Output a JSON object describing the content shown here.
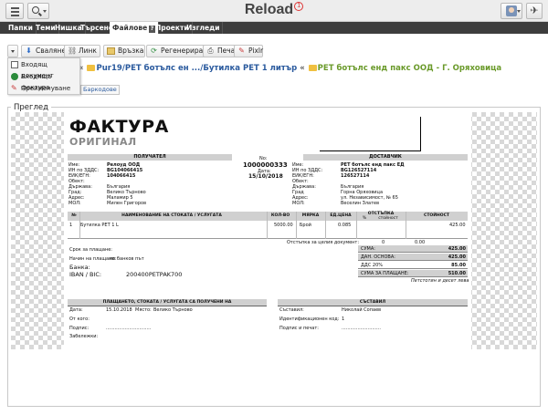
{
  "header": {
    "title": "Reload",
    "badge": "1",
    "pin_glyph": "✈"
  },
  "nav": {
    "tabs": [
      {
        "label": "Папки"
      },
      {
        "label": "Теми"
      },
      {
        "label": "Нишка"
      },
      {
        "label": "Търсене"
      },
      {
        "label": "Файлове",
        "badge": "?"
      },
      {
        "label": "Проекти"
      },
      {
        "label": "Изгледи"
      }
    ],
    "active": "Файлове"
  },
  "toolbar": {
    "download": "Сваляне",
    "link": "Линк",
    "relation": "Връзка",
    "regenerate": "Регенериране",
    "print": "Печат",
    "pixlr": "Pixlr"
  },
  "dropdown": {
    "items": [
      "Входящ документ",
      "Входяща фактура",
      "Преименуване"
    ]
  },
  "breadcrumb": {
    "part1": "Pur19/PET ботълс ен ...",
    "part2": "/Бутилка PET 1 литър",
    "part3": "PET ботълс енд пакс ООД - Г. Оряховица",
    "sep": "«"
  },
  "barcode_button": "Баркодове",
  "preview_label": "Преглед",
  "invoice": {
    "title": "ФАКТУРА",
    "subtitle": "ОРИГИНАЛ",
    "recipient_head": "ПОЛУЧАТЕЛ",
    "supplier_head": "ДОСТАВЧИК",
    "number_label": "No:",
    "number": "1000000333",
    "date_label": "Дата:",
    "date": "15/10/2018",
    "recipient": {
      "labels": [
        "Име:",
        "ИН по ЗДДС:",
        "ЕИК/ЕГН:",
        "Обект:",
        "Държава:",
        "Град:",
        "Адрес:",
        "МОЛ:"
      ],
      "values": [
        "Релоуд ООД",
        "BG104066415",
        "104066415",
        "",
        "България",
        "Велико Търново",
        "Маламир  5",
        "Милен Григоров"
      ]
    },
    "supplier": {
      "labels": [
        "Име:",
        "ИН по ЗДДС:",
        "ЕИК/ЕГН:",
        "Обект:",
        "Държава:",
        "Град",
        "Адрес:",
        "МОЛ:"
      ],
      "values": [
        "PET ботълс енд пакс ЕД",
        "BG126527114",
        "126527114",
        "",
        "България",
        "Горна Оряховица",
        "ул. Независимост, № 65",
        "Веселин Златев"
      ]
    },
    "table": {
      "headers": [
        "№",
        "НАИМЕНОВАНИЕ НА СТОКАТА / УСЛУГАТА",
        "КОЛ-ВО",
        "МЯРКА",
        "ЕД.ЦЕНА",
        "ОТСТЪПКА",
        "%",
        "стойност",
        "СТОЙНОСТ"
      ],
      "rows": [
        {
          "num": "1",
          "name": "Бутилка PET 1 L",
          "qty": "5000.00",
          "unit": "Брой",
          "price": "0.085",
          "total": "425.00"
        }
      ]
    },
    "discount_label": "Отстъпка за целия документ:",
    "discount_pct": "0",
    "discount_val": "0.00",
    "summary": [
      {
        "label": "СУМА:",
        "value": "425.00"
      },
      {
        "label": "ДАН. ОСНОВА:",
        "value": "425.00"
      },
      {
        "label": "ДДС 20%",
        "value": "85.00"
      },
      {
        "label": "СУМА ЗА ПЛАЩАНЕ:",
        "value": "510.00"
      }
    ],
    "words": "Петстотин и десет лева",
    "pay_term_label": "Срок за плащане:",
    "pay_method_label": "Начин на плащане:",
    "pay_method": "по банков път",
    "bank_label": "Банка:",
    "iban_label": "IBAN / BIC:",
    "iban": "200400PETPAK700",
    "receipt_head": "ПЛАЩАНЕТО, СТОКАТА / УСЛУГАТА СА ПОЛУЧЕНИ НА",
    "composed_head": "СЪСТАВИЛ",
    "receipt": {
      "date_label": "Дата:",
      "date": "15.10.2018",
      "place_label": "Място:",
      "place": "Велико Търново",
      "recipient_label": "От кого:",
      "sign_label": "Подпис:",
      "dots": "...............................",
      "notes_label": "Забележки:"
    },
    "composer": {
      "label": "Съставил:",
      "name": "Николай Сопаев",
      "id_label": "Идентификационен код:",
      "id": "1",
      "sign_label": "Подпис и печат:",
      "dots": "..........................."
    }
  }
}
